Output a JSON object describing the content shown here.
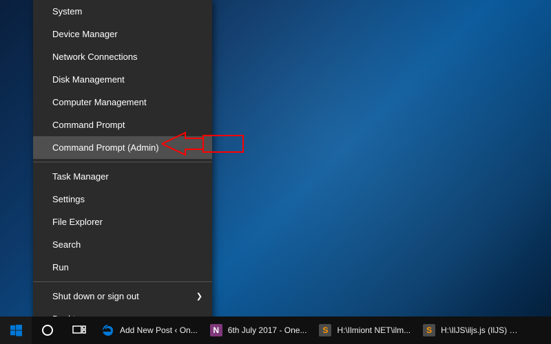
{
  "context_menu": {
    "groups": [
      [
        {
          "label": "System",
          "name": "menu-item-system"
        },
        {
          "label": "Device Manager",
          "name": "menu-item-device-manager"
        },
        {
          "label": "Network Connections",
          "name": "menu-item-network-connections"
        },
        {
          "label": "Disk Management",
          "name": "menu-item-disk-management"
        },
        {
          "label": "Computer Management",
          "name": "menu-item-computer-management"
        },
        {
          "label": "Command Prompt",
          "name": "menu-item-command-prompt"
        },
        {
          "label": "Command Prompt (Admin)",
          "name": "menu-item-command-prompt-admin",
          "hovered": true
        }
      ],
      [
        {
          "label": "Task Manager",
          "name": "menu-item-task-manager"
        },
        {
          "label": "Settings",
          "name": "menu-item-settings"
        },
        {
          "label": "File Explorer",
          "name": "menu-item-file-explorer"
        },
        {
          "label": "Search",
          "name": "menu-item-search"
        },
        {
          "label": "Run",
          "name": "menu-item-run"
        }
      ],
      [
        {
          "label": "Shut down or sign out",
          "name": "menu-item-shutdown",
          "submenu": true
        },
        {
          "label": "Desktop",
          "name": "menu-item-desktop"
        }
      ]
    ]
  },
  "taskbar": {
    "items": [
      {
        "label": "Add New Post ‹ On...",
        "name": "taskbar-item-edge",
        "icon": "edge",
        "icon_color": "#0078d7"
      },
      {
        "label": "6th July 2017 - One...",
        "name": "taskbar-item-onenote",
        "icon": "onenote",
        "icon_color": "#80397b",
        "icon_text": "N"
      },
      {
        "label": "H:\\Ilmiont NET\\ilm...",
        "name": "taskbar-item-sublime-1",
        "icon": "sublime",
        "icon_color": "#4b4b4b",
        "icon_text": "S"
      },
      {
        "label": "H:\\IlJS\\iljs.js (IlJS) - ...",
        "name": "taskbar-item-sublime-2",
        "icon": "sublime",
        "icon_color": "#4b4b4b",
        "icon_text": "S"
      }
    ]
  },
  "colors": {
    "callout": "#ff0000"
  }
}
